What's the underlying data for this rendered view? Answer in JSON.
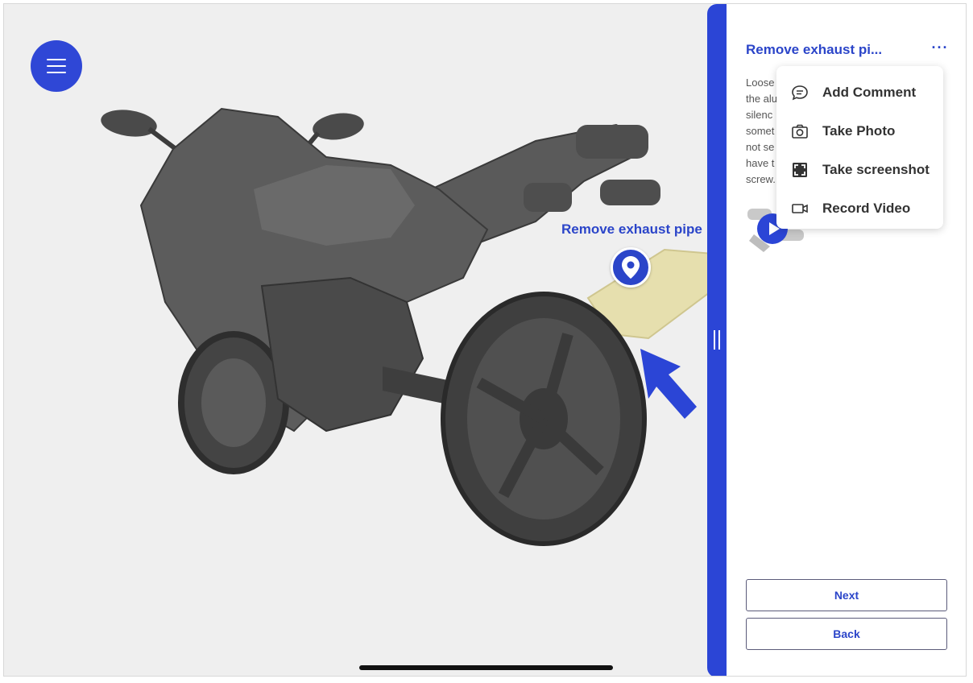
{
  "viewer": {
    "menu_icon": "hamburger-icon",
    "hotspot": {
      "label": "Remove exhaust pipe",
      "icon": "map-pin-icon"
    }
  },
  "panel": {
    "title": "Remove exhaust pi...",
    "more_icon": "more-horizontal-icon",
    "more_label": "···",
    "description_lines": [
      "Loose",
      "the alu",
      "silenc",
      "somet",
      "not se",
      "have t",
      "screw."
    ],
    "media": {
      "type": "video",
      "icon": "play-icon"
    },
    "next_label": "Next",
    "back_label": "Back"
  },
  "context_menu": {
    "items": [
      {
        "label": "Add Comment",
        "icon": "comment-icon"
      },
      {
        "label": "Take Photo",
        "icon": "camera-icon"
      },
      {
        "label": "Take screenshot",
        "icon": "screenshot-icon"
      },
      {
        "label": "Record Video",
        "icon": "video-camera-icon"
      }
    ]
  },
  "colors": {
    "accent": "#2b45d6",
    "viewport_bg": "#efefef",
    "model": "#555555",
    "highlight_part": "#e6dfae"
  }
}
